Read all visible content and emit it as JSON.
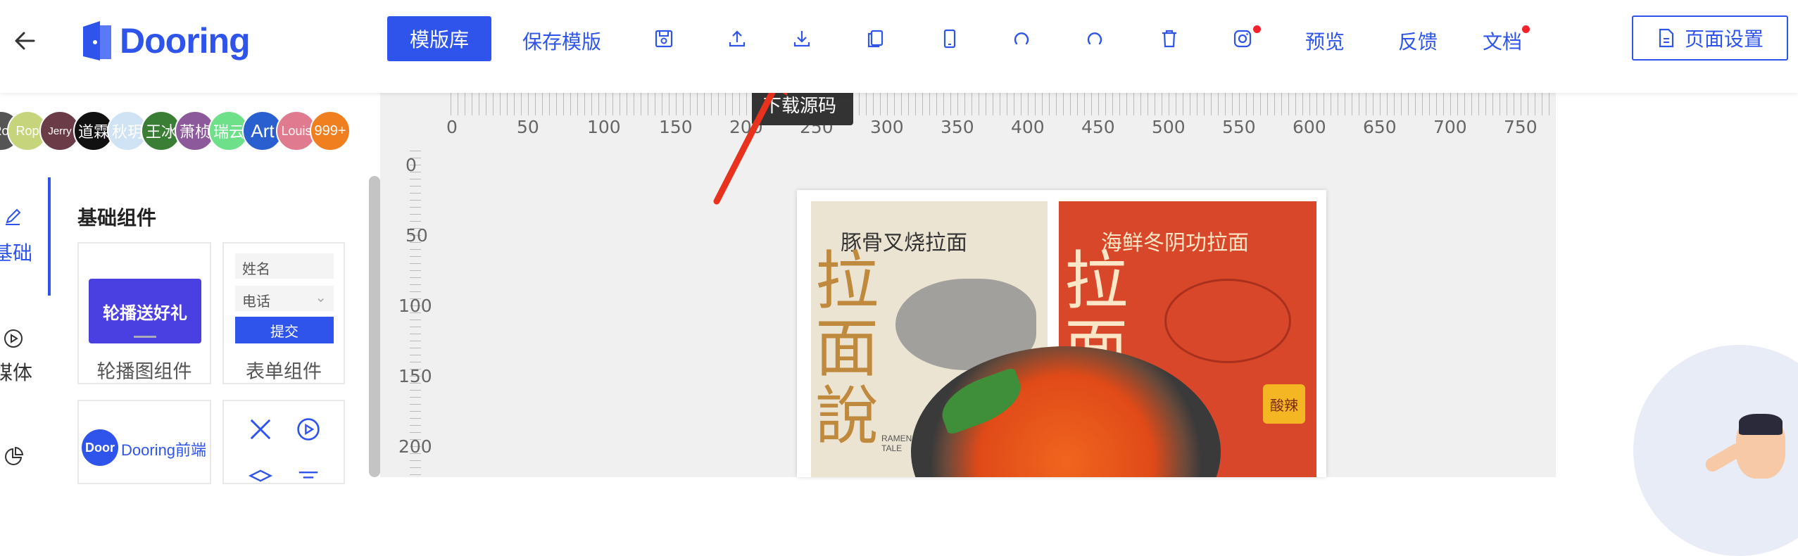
{
  "header": {
    "brand": "Dooring",
    "template_lib": "模版库",
    "save_template": "保存模版",
    "preview": "预览",
    "feedback": "反馈",
    "docs": "文档",
    "page_settings": "页面设置",
    "tooltip": "下载源码"
  },
  "avatars": [
    "Ro",
    "Rop",
    "Jerry",
    "道霖",
    "秋玥",
    "王冰",
    "萧桢",
    "瑞云",
    "Art",
    "Louis",
    "999+"
  ],
  "sidebar": {
    "tabs": [
      {
        "label": "基础"
      },
      {
        "label": "媒体"
      }
    ],
    "section_title": "基础组件",
    "components": [
      {
        "label": "轮播图组件",
        "preview_text": "轮播送好礼"
      },
      {
        "label": "表单组件",
        "field1": "姓名",
        "field2": "电话",
        "submit": "提交"
      }
    ],
    "dooring_card": {
      "logo": "Door",
      "text": "Dooring前端"
    }
  },
  "ruler": {
    "h_ticks": [
      "0",
      "50",
      "100",
      "150",
      "200",
      "250",
      "300",
      "350",
      "400",
      "450",
      "500",
      "550",
      "600",
      "650",
      "700",
      "750"
    ],
    "v_ticks": [
      "0",
      "50",
      "100",
      "150",
      "200"
    ]
  },
  "poster": {
    "left_box": {
      "title": "豚骨叉烧拉面",
      "big1": "拉",
      "big2": "面",
      "big3": "說",
      "sub": "RAMEN TALE"
    },
    "right_box": {
      "title": "海鲜冬阴功拉面",
      "big1": "拉",
      "big2": "面",
      "badge": "酸辣"
    }
  },
  "colors": {
    "accent": "#2f54eb",
    "red_dot": "#f5222d",
    "arrow": "#e8321e"
  }
}
